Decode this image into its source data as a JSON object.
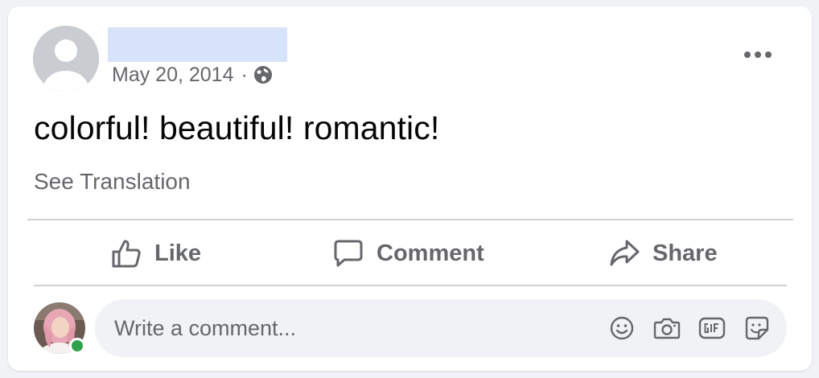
{
  "post": {
    "date": "May 20, 2014",
    "separator": "·",
    "audience_icon": "globe-icon",
    "more_icon": "ellipsis-icon",
    "text": "colorful! beautiful! romantic!",
    "see_translation": "See Translation"
  },
  "actions": {
    "like": {
      "label": "Like",
      "icon": "thumbs-up-icon"
    },
    "comment": {
      "label": "Comment",
      "icon": "speech-bubble-icon"
    },
    "share": {
      "label": "Share",
      "icon": "share-arrow-icon"
    }
  },
  "composer": {
    "placeholder": "Write a comment...",
    "icons": [
      "emoji-icon",
      "camera-icon",
      "gif-icon",
      "sticker-icon"
    ],
    "online_status_color": "#31a24c"
  },
  "colors": {
    "secondary_text": "#65676b",
    "primary_text": "#050505",
    "card_bg": "#ffffff",
    "page_bg": "#f0f2f5",
    "redacted_name_bg": "#d6e3fb"
  }
}
